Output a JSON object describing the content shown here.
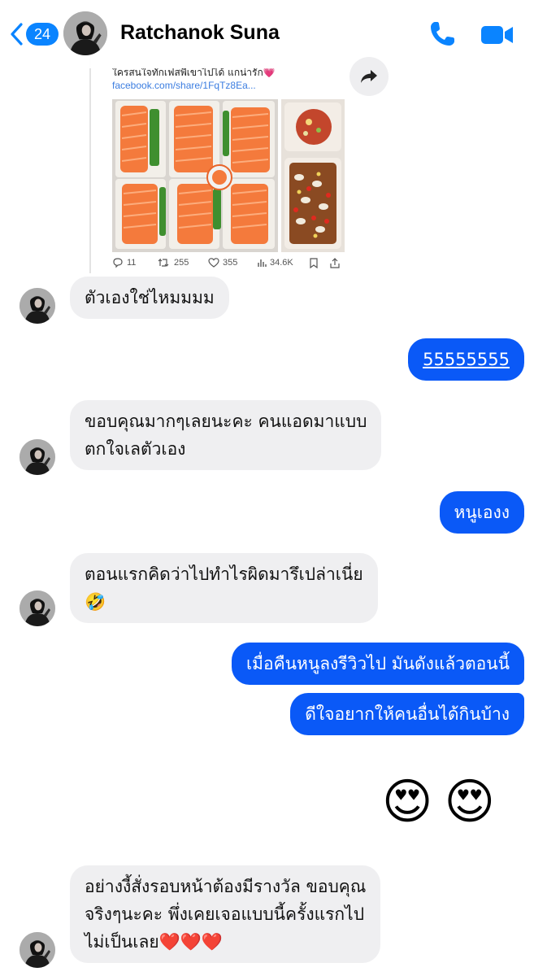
{
  "header": {
    "unread_count": "24",
    "contact_name": "Ratchanok Suna"
  },
  "shared_post": {
    "caption": "ใครสนใจทักเฟสพี่เขาไปได้ แกน่ารัก💗",
    "link": "facebook.com/share/1FqTz8Ea...",
    "stats": {
      "replies": "11",
      "reposts": "255",
      "likes": "355",
      "views": "34.6K"
    }
  },
  "messages": [
    {
      "direction": "incoming",
      "text": "ตัวเองใช่ไหมมมม"
    },
    {
      "direction": "outgoing",
      "text": "55555555"
    },
    {
      "direction": "incoming",
      "lines": [
        "ขอบคุณมากๆเลยนะคะ คนแอดมาแบบ",
        "ตกใจเลตัวเอง"
      ]
    },
    {
      "direction": "outgoing",
      "text": "หนูเองง"
    },
    {
      "direction": "incoming",
      "lines": [
        "ตอนแรกคิดว่าไปทำไรผิดมารึเปล่าเนี่ย",
        "🤣"
      ]
    },
    {
      "direction": "outgoing",
      "text": "เมื่อคืนหนูลงรีวิวไป มันดังแล้วตอนนี้"
    },
    {
      "direction": "outgoing",
      "text": "ดีใจอยากให้คนอื่นได้กินบ้าง"
    },
    {
      "direction": "outgoing",
      "text": "😍😍"
    },
    {
      "direction": "incoming",
      "lines": [
        "อย่างงี้สั่งรอบหน้าต้องมีรางวัล ขอบคุณ",
        "จริงๆนะคะ พึ่งเคยเจอแบบนี้ครั้งแรกไป",
        "ไม่เป็นเลย❤️❤️❤️"
      ]
    }
  ],
  "colors": {
    "accent": "#0a84ff",
    "outgoing_bubble": "#0a59f7",
    "incoming_bubble": "#efeff1"
  },
  "icons": {
    "back": "chevron-left-icon",
    "call": "phone-icon",
    "video": "video-camera-icon",
    "share": "share-arrow-icon"
  }
}
